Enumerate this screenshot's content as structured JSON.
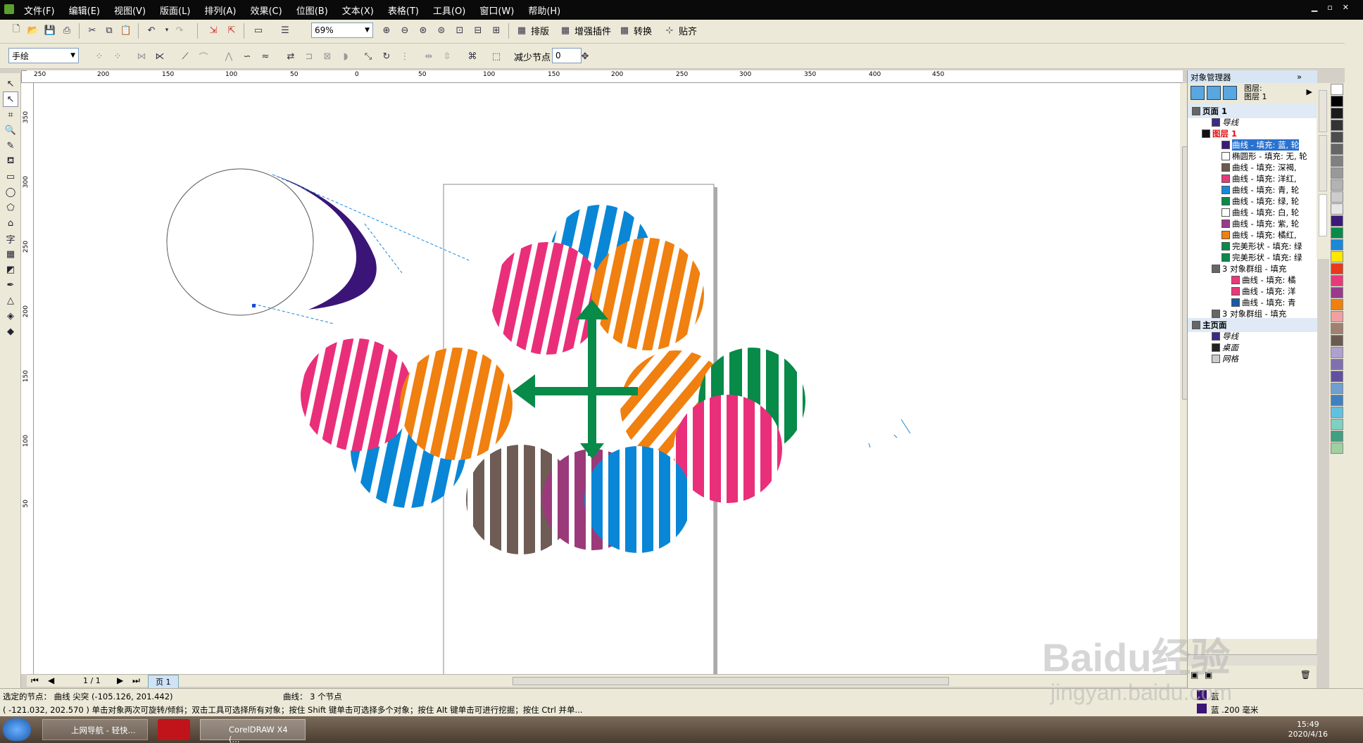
{
  "menu": [
    "文件(F)",
    "编辑(E)",
    "视图(V)",
    "版面(L)",
    "排列(A)",
    "效果(C)",
    "位图(B)",
    "文本(X)",
    "表格(T)",
    "工具(O)",
    "窗口(W)",
    "帮助(H)"
  ],
  "toolbar": {
    "zoom": "69%",
    "pai_ban": "排版",
    "plugins": "增强插件",
    "convert": "转换",
    "snap": "贴齐"
  },
  "propbar": {
    "tool_mode": "手绘",
    "reduce_nodes_label": "减少节点",
    "reduce_nodes_value": "0"
  },
  "hruler_ticks": [
    "250",
    "200",
    "150",
    "100",
    "50",
    "0",
    "50",
    "100",
    "150",
    "200",
    "250",
    "300",
    "350",
    "400",
    "450"
  ],
  "vruler_ticks": [
    "350",
    "300",
    "250",
    "200",
    "150",
    "100",
    "50"
  ],
  "pagebar": {
    "page_count": "1 / 1",
    "page_tab": "页 1"
  },
  "status": {
    "line1": "选定的节点：  曲线 尖突 (-105.126, 201.442)",
    "line1b": "曲线：  3 个节点",
    "line2": "( -121.032, 202.570 )   单击对象两次可旋转/倾斜；双击工具可选择所有对象；按住 Shift 键单击可选择多个对象；按住 Alt 键单击可进行挖掘；按住 Ctrl 并单...",
    "fill_label": "蓝",
    "outline_label": "蓝  .200 毫米"
  },
  "objmgr": {
    "title": "对象管理器",
    "layer_label": "图层:",
    "layer_value": "图层 1",
    "tree": [
      {
        "text": "页面 1",
        "indent": 0,
        "kind": "page"
      },
      {
        "text": "导线",
        "indent": 2,
        "kind": "layer",
        "color": "#3b2a8a"
      },
      {
        "text": "图层 1",
        "indent": 1,
        "kind": "layer-red",
        "color": "#111111"
      },
      {
        "text": "曲线 - 填充: 蓝, 轮",
        "indent": 3,
        "kind": "sel",
        "color": "#3b1a7a"
      },
      {
        "text": "椭圆形 - 填充: 无, 轮",
        "indent": 3,
        "kind": "item",
        "color": "#ffffff"
      },
      {
        "text": "曲线 - 填充: 深褐,",
        "indent": 3,
        "kind": "item",
        "color": "#6b5a50"
      },
      {
        "text": "曲线 - 填充: 洋红,",
        "indent": 3,
        "kind": "item",
        "color": "#e83a7a"
      },
      {
        "text": "曲线 - 填充: 青, 轮",
        "indent": 3,
        "kind": "item",
        "color": "#1a88d8"
      },
      {
        "text": "曲线 - 填充: 绿, 轮",
        "indent": 3,
        "kind": "item",
        "color": "#0a8a4a"
      },
      {
        "text": "曲线 - 填充: 白, 轮",
        "indent": 3,
        "kind": "item",
        "color": "#ffffff"
      },
      {
        "text": "曲线 - 填充: 紫, 轮",
        "indent": 3,
        "kind": "item",
        "color": "#9a3a8a"
      },
      {
        "text": "曲线 - 填充: 橘红,",
        "indent": 3,
        "kind": "item",
        "color": "#f08010"
      },
      {
        "text": "完美形状 - 填充: 绿",
        "indent": 3,
        "kind": "item",
        "color": "#0a8a4a"
      },
      {
        "text": "完美形状 - 填充: 绿",
        "indent": 3,
        "kind": "item",
        "color": "#0a8a4a"
      },
      {
        "text": "3 对象群组 - 填充",
        "indent": 2,
        "kind": "group",
        "color": "#666666"
      },
      {
        "text": "曲线 - 填充: 橘",
        "indent": 4,
        "kind": "item",
        "color": "#e83a7a"
      },
      {
        "text": "曲线 - 填充: 洋",
        "indent": 4,
        "kind": "item",
        "color": "#e83a7a"
      },
      {
        "text": "曲线 - 填充: 青",
        "indent": 4,
        "kind": "item",
        "color": "#1a5aa8"
      },
      {
        "text": "3 对象群组 - 填充",
        "indent": 2,
        "kind": "group",
        "color": "#666666"
      },
      {
        "text": "主页面",
        "indent": 0,
        "kind": "page"
      },
      {
        "text": "导线",
        "indent": 2,
        "kind": "layer",
        "color": "#3b2a8a"
      },
      {
        "text": "桌面",
        "indent": 2,
        "kind": "layer",
        "color": "#222222"
      },
      {
        "text": "网格",
        "indent": 2,
        "kind": "layer",
        "color": "#cccccc"
      }
    ]
  },
  "palette_colors": [
    "#ffffff",
    "#000000",
    "#1a1a1a",
    "#333333",
    "#4d4d4d",
    "#666666",
    "#808080",
    "#999999",
    "#b3b3b3",
    "#cccccc",
    "#e6e6e6",
    "#3b1a7a",
    "#0a8a4a",
    "#1a88d8",
    "#ffe800",
    "#e83a1a",
    "#e83a7a",
    "#9a3a8a",
    "#f08010",
    "#f0a0a0",
    "#a08070",
    "#6b5a50",
    "#b0a0d0",
    "#8070b0",
    "#6050a0",
    "#70a0d0",
    "#4080c0",
    "#60c0e0",
    "#80d0c0",
    "#40a080",
    "#a0d0a0"
  ],
  "taskbar": {
    "items": [
      "上网导航 - 轻快...",
      "CorelDRAW X4 (..."
    ],
    "time": "15:49",
    "date": "2020/4/16"
  },
  "watermark": {
    "brand": "Baidu经验",
    "url": "jingyan.baidu.com"
  },
  "colors": {
    "pink": "#ea2f7a",
    "orange": "#f0800f",
    "blue": "#0a86d6",
    "green": "#088a48",
    "brown": "#6e5c55",
    "purple": "#9b3a7a",
    "indigo": "#3a1577"
  }
}
